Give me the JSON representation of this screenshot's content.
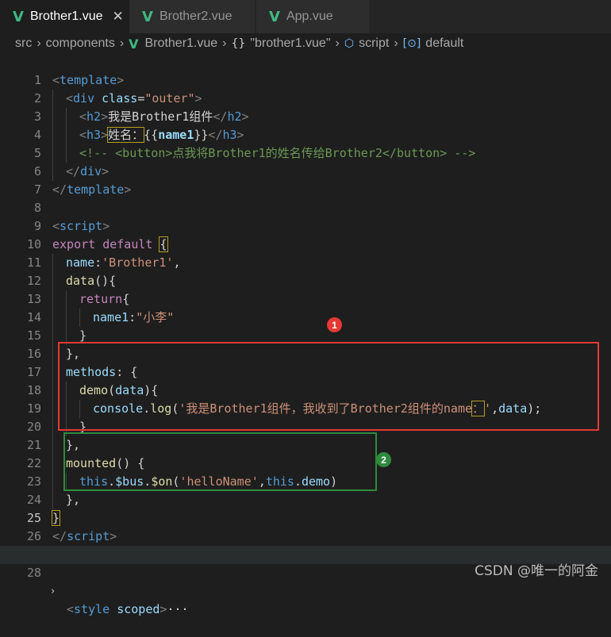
{
  "tabs": [
    {
      "label": "Brother1.vue",
      "close": "✕"
    },
    {
      "label": "Brother2.vue"
    },
    {
      "label": "App.vue"
    }
  ],
  "breadcrumb": [
    "src",
    "components",
    "Brother1.vue",
    "\"brother1.vue\"",
    "script",
    "default"
  ],
  "annotations": {
    "badge1": "1",
    "badge2": "2"
  },
  "watermark": "CSDN @唯一的阿金",
  "code": {
    "l3_text": "我是Brother1组件",
    "l4_text": "姓名：",
    "l4_expr": "name1",
    "l5_comment": "<!-- <button>点我将Brother1的姓名传给Brother2</button> -->",
    "l11_value": "'Brother1'",
    "l14_value": "\"小李\"",
    "l19_string_a": "'我是Brother1组件，我收到了Brother2组件的name",
    "l19_string_b": "：",
    "l19_string_c": "'",
    "l23_event": "'helloName'",
    "l28_ellipsis": "···"
  }
}
